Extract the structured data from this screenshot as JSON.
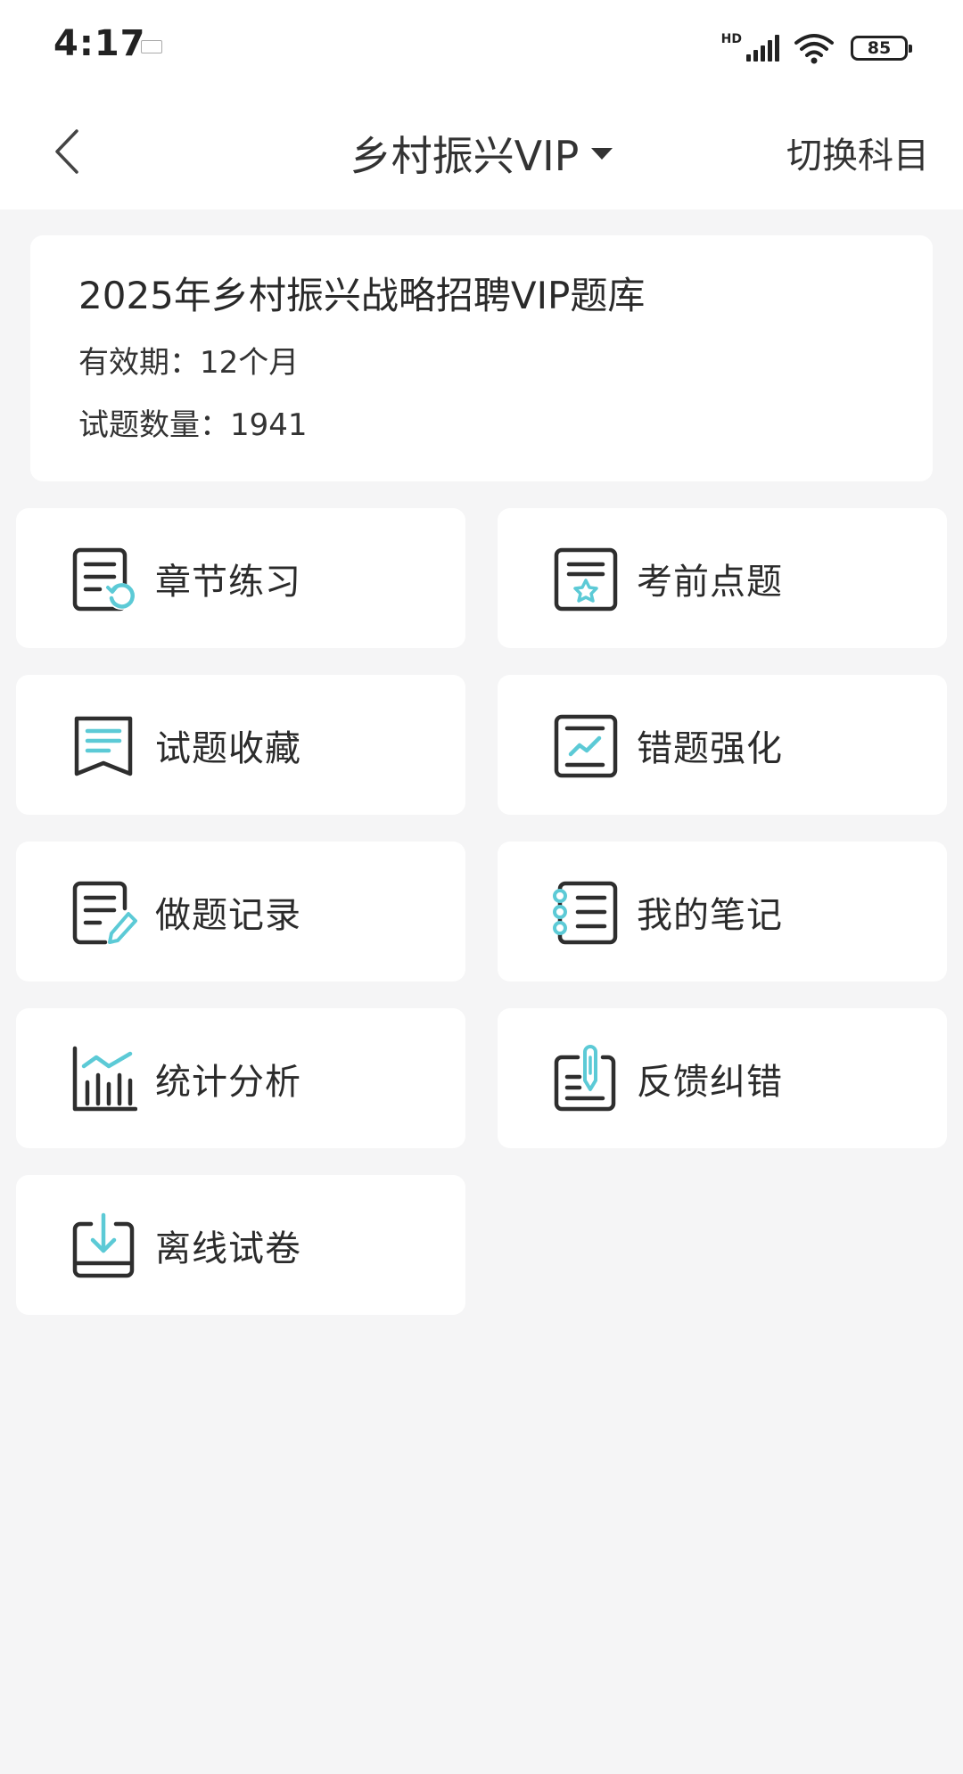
{
  "status_bar": {
    "time": "4:17",
    "network_label": "HD",
    "battery": "85",
    "icons": [
      "notification-icon",
      "signal-icon",
      "wifi-icon",
      "battery-icon"
    ]
  },
  "nav": {
    "back_icon": "chevron-left-icon",
    "title": "乡村振兴VIP",
    "dropdown_icon": "caret-down-icon",
    "switch_label": "切换科目"
  },
  "info": {
    "title": "2025年乡村振兴战略招聘VIP题库",
    "validity": "有效期：12个月",
    "question_count": "试题数量：1941"
  },
  "menu": [
    {
      "label": "章节练习",
      "icon": "chapter-practice-icon"
    },
    {
      "label": "考前点题",
      "icon": "pre-exam-star-icon"
    },
    {
      "label": "试题收藏",
      "icon": "bookmark-icon"
    },
    {
      "label": "错题强化",
      "icon": "trend-chart-icon"
    },
    {
      "label": "做题记录",
      "icon": "edit-record-icon"
    },
    {
      "label": "我的笔记",
      "icon": "notebook-icon"
    },
    {
      "label": "统计分析",
      "icon": "bar-chart-icon"
    },
    {
      "label": "反馈纠错",
      "icon": "feedback-pen-icon"
    },
    {
      "label": "离线试卷",
      "icon": "download-icon"
    }
  ],
  "colors": {
    "accent": "#5ccad6",
    "icon_stroke": "#2e2e2e",
    "background": "#f5f5f6",
    "card": "#ffffff"
  }
}
